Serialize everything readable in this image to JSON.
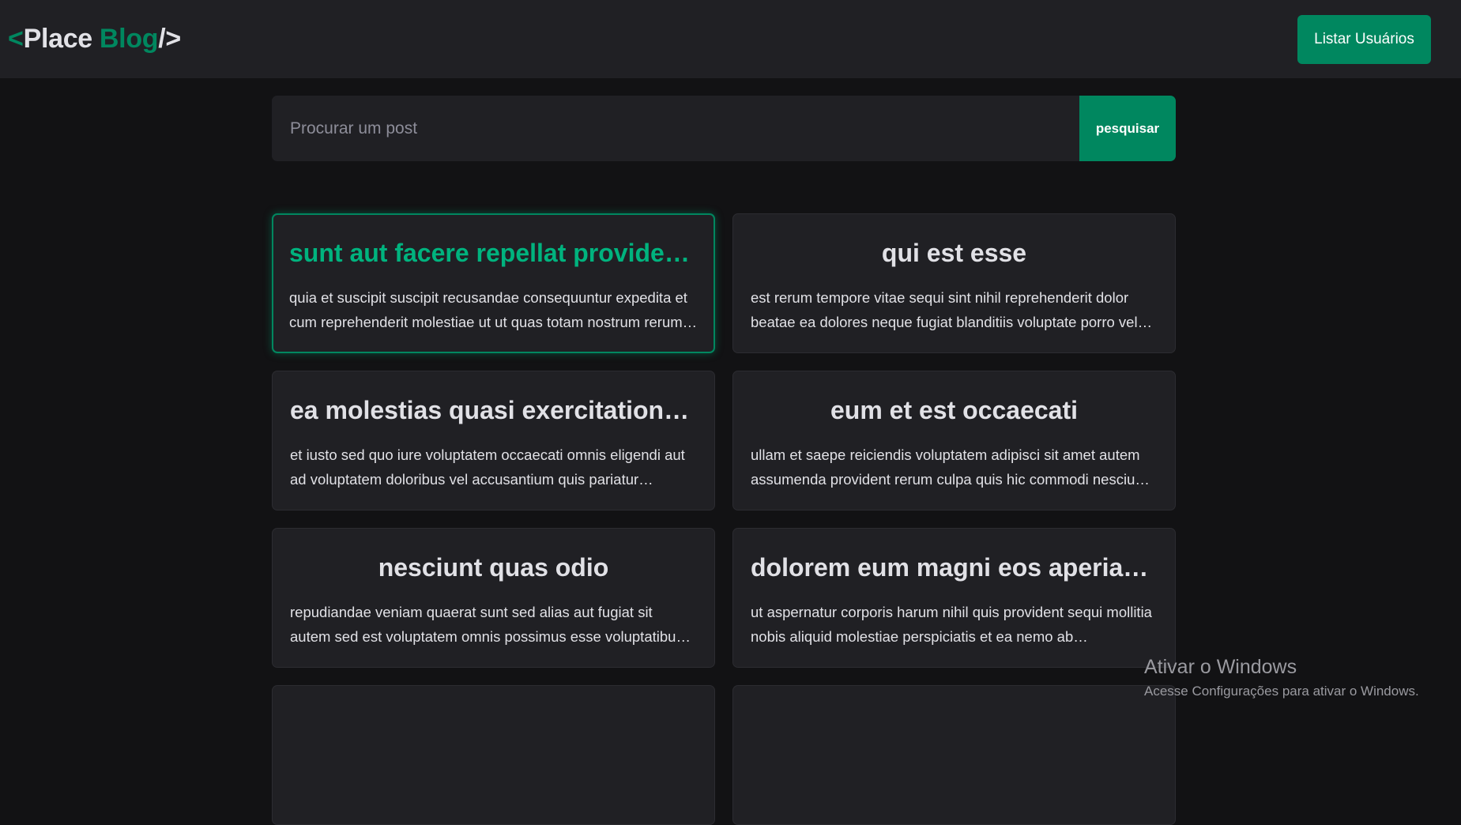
{
  "header": {
    "logo": {
      "open_bracket": "<",
      "word1": "Place",
      "word2": "Blog",
      "close_bracket": "/>"
    },
    "users_button": "Listar Usuários"
  },
  "search": {
    "placeholder": "Procurar um post",
    "button": "pesquisar"
  },
  "posts": [
    {
      "title": "sunt aut facere repellat provident occaecati excepturi optio reprehenderit",
      "body": "quia et suscipit suscipit recusandae consequuntur expedita et cum reprehenderit molestiae ut ut quas totam nostrum rerum est autem sunt rem eveniet architecto",
      "active": true
    },
    {
      "title": "qui est esse",
      "body": "est rerum tempore vitae sequi sint nihil reprehenderit dolor beatae ea dolores neque fugiat blanditiis voluptate porro vel nihil molestiae ut reiciendis qui aperiam non debitis possimus qui neque nisi nulla"
    },
    {
      "title": "ea molestias quasi exercitationem repellat qui ipsa sit aut",
      "body": "et iusto sed quo iure voluptatem occaecati omnis eligendi aut ad voluptatem doloribus vel accusantium quis pariatur molestiae porro eius odio et labore et velit aut"
    },
    {
      "title": "eum et est occaecati",
      "body": "ullam et saepe reiciendis voluptatem adipisci sit amet autem assumenda provident rerum culpa quis hic commodi nesciunt rem tenetur doloremque ipsam iure quis sunt voluptatem rerum illo velit"
    },
    {
      "title": "nesciunt quas odio",
      "body": "repudiandae veniam quaerat sunt sed alias aut fugiat sit autem sed est voluptatem omnis possimus esse voluptatibus quis est aut tenetur dolor neque"
    },
    {
      "title": "dolorem eum magni eos aperiam quia",
      "body": "ut aspernatur corporis harum nihil quis provident sequi mollitia nobis aliquid molestiae perspiciatis et ea nemo ab reprehenderit accusantium quas voluptate dolores velit et doloremque molestiae"
    },
    {
      "title": "",
      "body": ""
    },
    {
      "title": "",
      "body": ""
    }
  ],
  "watermark": {
    "title": "Ativar o Windows",
    "subtitle": "Acesse Configurações para ativar o Windows."
  },
  "colors": {
    "accent": "#00875f",
    "accent_light": "#00b37e",
    "background": "#121214",
    "surface": "#202024"
  }
}
